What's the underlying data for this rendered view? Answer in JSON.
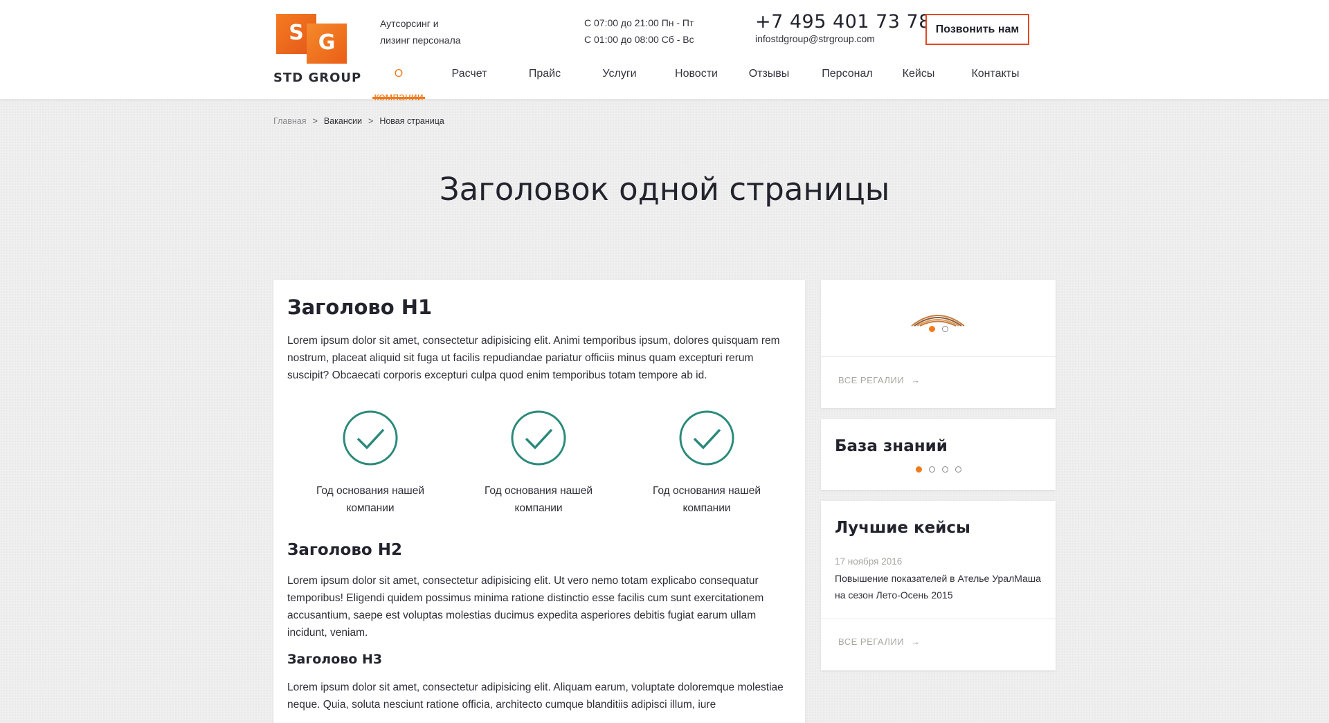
{
  "header": {
    "logo_text": "STD GROUP",
    "logo_letters": [
      "S",
      "G"
    ],
    "tagline": [
      "Аутсорсинг и",
      "лизинг персонала"
    ],
    "hours": [
      "С 07:00 до 21:00 Пн - Пт",
      "С 01:00 до 08:00 Сб - Вс"
    ],
    "phone": "+7 495 401 73 78",
    "email": "infostdgroup@strgroup.com",
    "call_button": "Позвонить нам"
  },
  "nav": [
    {
      "label": "О компании",
      "active": true
    },
    {
      "label": "Расчет"
    },
    {
      "label": "Прайс"
    },
    {
      "label": "Услуги"
    },
    {
      "label": "Новости"
    },
    {
      "label": "Отзывы"
    },
    {
      "label": "Персонал"
    },
    {
      "label": "Кейсы"
    },
    {
      "label": "Контакты"
    }
  ],
  "breadcrumb": {
    "items": [
      "Главная",
      "Вакансии",
      "Новая страница"
    ],
    "separator": ">"
  },
  "page_title": "Заголовок одной страницы",
  "main": {
    "h1": "Заголово H1",
    "p1": "Lorem ipsum dolor sit amet, consectetur adipisicing elit. Animi temporibus ipsum, dolores quisquam rem nostrum, placeat aliquid sit fuga ut facilis repudiandae pariatur officiis minus quam excepturi rerum suscipit? Obcaecati corporis excepturi culpa quod enim temporibus totam tempore ab id.",
    "features": [
      {
        "label": "Год основания нашей компании"
      },
      {
        "label": "Год основания нашей компании"
      },
      {
        "label": "Год основания нашей компании"
      }
    ],
    "h2": "Заголово H2",
    "p2": "Lorem ipsum dolor sit amet, consectetur adipisicing elit. Ut vero nemo totam explicabo consequatur temporibus! Eligendi quidem possimus minima ratione distinctio esse facilis cum sunt exercitationem accusantium, saepe est voluptas molestias ducimus expedita asperiores debitis fugiat earum ullam incidunt, veniam.",
    "h3": "Заголово H3",
    "p3": "Lorem ipsum dolor sit amet, consectetur adipisicing elit. Aliquam earum, voluptate doloremque molestiae neque. Quia, soluta nesciunt ratione officia, architecto cumque blanditiis adipisci illum, iure"
  },
  "sidebar": {
    "awards": {
      "link": "ВСЕ РЕГАЛИИ",
      "slides": 2,
      "active_slide": 0
    },
    "knowledge": {
      "title": "База знаний",
      "slides": 4,
      "active_slide": 0
    },
    "cases": {
      "title": "Лучшие кейсы",
      "date": "17 ноября 2016",
      "text": "Повышение показателей в Ателье УралМаша на сезон Лето-Осень 2015",
      "link": "ВСЕ РЕГАЛИИ"
    }
  },
  "colors": {
    "accent": "#f07b1c",
    "check": "#2a8a7a",
    "button_border": "#e4481f"
  }
}
